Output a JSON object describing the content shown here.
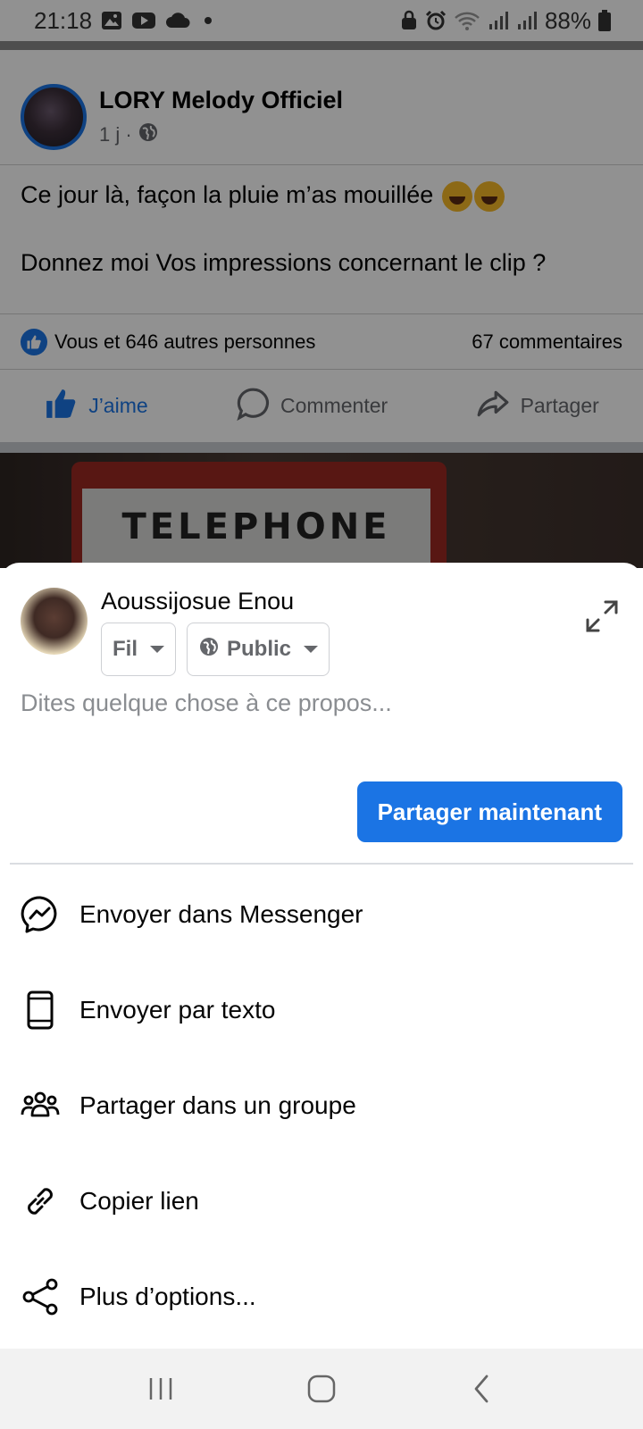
{
  "status_bar": {
    "time": "21:18",
    "battery": "88%",
    "left_icons": [
      "gallery-icon",
      "youtube-icon",
      "cloud-icon",
      "dot-icon"
    ],
    "right_icons": [
      "lock-icon",
      "alarm-icon",
      "wifi-icon",
      "signal-icon",
      "signal-icon",
      "battery-icon"
    ]
  },
  "post": {
    "page_name": "LORY Melody Officiel",
    "time": "1 j ·",
    "text_line1": "Ce jour là, façon la pluie m’as mouillée",
    "text_line2": "Donnez moi Vos impressions concernant le clip ?",
    "reactions": "Vous et 646 autres personnes",
    "comments": "67 commentaires",
    "actions": {
      "like": "J’aime",
      "comment": "Commenter",
      "share": "Partager"
    },
    "video_sign": "TELEPHONE"
  },
  "share_sheet": {
    "user_name": "Aoussijosue Enou",
    "destination": "Fil",
    "audience": "Public",
    "placeholder": "Dites quelque chose à ce propos...",
    "share_now": "Partager maintenant",
    "options": [
      {
        "label": "Envoyer dans Messenger",
        "icon": "messenger-icon"
      },
      {
        "label": "Envoyer par texto",
        "icon": "phone-icon"
      },
      {
        "label": "Partager dans un groupe",
        "icon": "group-icon"
      },
      {
        "label": "Copier lien",
        "icon": "link-icon"
      },
      {
        "label": "Plus d’options...",
        "icon": "share-icon"
      }
    ]
  },
  "colors": {
    "accent": "#1b74e4",
    "secondary_text": "#65676b",
    "overlay": "rgba(0,0,0,0.43)"
  }
}
